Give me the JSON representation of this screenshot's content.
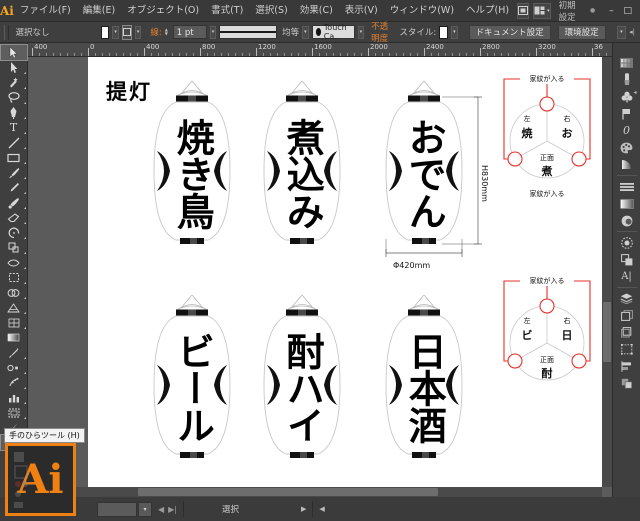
{
  "app": {
    "logo": "Ai",
    "window_buttons": {
      "minimize": "–",
      "maximize": "□",
      "close": "✕"
    }
  },
  "menubar": {
    "items": [
      {
        "label": "ファイル(F)",
        "name": "menu-file"
      },
      {
        "label": "編集(E)",
        "name": "menu-edit"
      },
      {
        "label": "オブジェクト(O)",
        "name": "menu-object"
      },
      {
        "label": "書式(T)",
        "name": "menu-type"
      },
      {
        "label": "選択(S)",
        "name": "menu-select"
      },
      {
        "label": "効果(C)",
        "name": "menu-effect"
      },
      {
        "label": "表示(V)",
        "name": "menu-view"
      },
      {
        "label": "ウィンドウ(W)",
        "name": "menu-window"
      },
      {
        "label": "ヘルプ(H)",
        "name": "menu-help"
      }
    ],
    "workspace": "初期設定"
  },
  "controlbar": {
    "selection_status": "選択なし",
    "stroke_label": "線:",
    "stroke_weight": "1 pt",
    "stroke_profile": "均等",
    "brush_name": "Touch Ca..",
    "opacity_label": "不透明度",
    "style_label": "スタイル:",
    "document_setup": "ドキュメント設定",
    "preferences": "環境設定"
  },
  "rulers": {
    "horizontal_labels": [
      "400",
      "0",
      "400",
      "800",
      "1200",
      "1600",
      "2000",
      "2400",
      "2800",
      "3200",
      "36"
    ],
    "unit": "mm"
  },
  "toolbar": {
    "tools": [
      {
        "name": "selection-tool",
        "icon": "cursor-arrow-icon",
        "selected": false
      },
      {
        "name": "direct-selection-tool",
        "icon": "direct-cursor-icon",
        "selected": false
      },
      {
        "name": "magic-wand-tool",
        "icon": "magic-wand-icon",
        "selected": false
      },
      {
        "name": "lasso-tool",
        "icon": "lasso-icon",
        "selected": false
      },
      {
        "name": "pen-tool",
        "icon": "pen-icon",
        "selected": false
      },
      {
        "name": "type-tool",
        "icon": "type-t-icon",
        "selected": false
      },
      {
        "name": "line-segment-tool",
        "icon": "line-icon",
        "selected": false
      },
      {
        "name": "rectangle-tool",
        "icon": "rectangle-icon",
        "selected": false
      },
      {
        "name": "paintbrush-tool",
        "icon": "paintbrush-icon",
        "selected": false
      },
      {
        "name": "pencil-tool",
        "icon": "pencil-icon",
        "selected": false
      },
      {
        "name": "blob-brush-tool",
        "icon": "blob-brush-icon",
        "selected": false
      },
      {
        "name": "eraser-tool",
        "icon": "eraser-icon",
        "selected": false
      },
      {
        "name": "rotate-tool",
        "icon": "rotate-icon",
        "selected": false
      },
      {
        "name": "scale-tool",
        "icon": "scale-icon",
        "selected": false
      },
      {
        "name": "width-tool",
        "icon": "width-warp-icon",
        "selected": false
      },
      {
        "name": "free-transform-tool",
        "icon": "free-transform-icon",
        "selected": false
      },
      {
        "name": "shape-builder-tool",
        "icon": "shape-builder-icon",
        "selected": false
      },
      {
        "name": "perspective-grid-tool",
        "icon": "perspective-grid-icon",
        "selected": false
      },
      {
        "name": "mesh-tool",
        "icon": "mesh-icon",
        "selected": false
      },
      {
        "name": "gradient-tool",
        "icon": "gradient-icon",
        "selected": false
      },
      {
        "name": "eyedropper-tool",
        "icon": "eyedropper-icon",
        "selected": false
      },
      {
        "name": "blend-tool",
        "icon": "blend-icon",
        "selected": false
      },
      {
        "name": "symbol-sprayer-tool",
        "icon": "symbol-sprayer-icon",
        "selected": false
      },
      {
        "name": "column-graph-tool",
        "icon": "bar-graph-icon",
        "selected": false
      },
      {
        "name": "artboard-tool",
        "icon": "artboard-icon",
        "selected": false
      },
      {
        "name": "slice-tool",
        "icon": "slice-knife-icon",
        "selected": false
      },
      {
        "name": "hand-tool",
        "icon": "hand-icon",
        "selected": true
      }
    ],
    "tooltip": "手のひらツール (H)"
  },
  "rightdock": {
    "buttons": [
      {
        "name": "panel-color-guide",
        "icon": "color-guide-icon"
      },
      {
        "name": "panel-brushes",
        "icon": "brush-panel-icon"
      },
      {
        "name": "panel-symbols",
        "icon": "clover-symbol-icon"
      },
      {
        "name": "panel-flag",
        "icon": "flag-icon"
      },
      {
        "name": "panel-stroke",
        "icon": "stroke-zero-icon"
      },
      {
        "name": "panel-color",
        "icon": "color-wheel-icon"
      },
      {
        "name": "panel-gradient",
        "icon": "gradient-panel-icon"
      },
      {
        "name": "panel-align",
        "icon": "align-lines-icon"
      },
      {
        "name": "panel-transparency",
        "icon": "transparency-icon"
      },
      {
        "name": "panel-appearance",
        "icon": "appearance-circle-icon"
      },
      {
        "name": "panel-graphic-styles",
        "icon": "graphic-styles-icon"
      },
      {
        "name": "panel-pathfinder",
        "icon": "pathfinder-icon"
      },
      {
        "name": "panel-character",
        "icon": "character-a-icon"
      },
      {
        "name": "panel-layers",
        "icon": "layers-stack-icon"
      },
      {
        "name": "panel-artboards",
        "icon": "artboards-panel-icon"
      },
      {
        "name": "panel-links",
        "icon": "links-icon"
      },
      {
        "name": "panel-transform",
        "icon": "transform-grid-icon"
      },
      {
        "name": "panel-align-objects",
        "icon": "align-objects-icon"
      },
      {
        "name": "panel-pathfinder2",
        "icon": "pathfinder-shapes-icon"
      }
    ]
  },
  "document": {
    "title": "提灯",
    "lanterns": [
      {
        "name": "lantern-yakitori",
        "text": "焼き鳥",
        "chars": 3
      },
      {
        "name": "lantern-nikomi",
        "text": "煮込み",
        "chars": 3
      },
      {
        "name": "lantern-oden",
        "text": "おでん",
        "chars": 3
      },
      {
        "name": "lantern-beer",
        "text": "ビール",
        "chars": 3
      },
      {
        "name": "lantern-chuhai",
        "text": "酎ハイ",
        "chars": 3
      },
      {
        "name": "lantern-nihonshu",
        "text": "日本酒",
        "chars": 3
      }
    ],
    "dimensions": {
      "height": "H830mm",
      "diameter": "Φ420mm"
    },
    "crest_diagrams": [
      {
        "name": "crest-diagram-top",
        "top_label": "家紋が入る",
        "bottom_label": "家紋が入る",
        "left_label": "左",
        "right_label": "右",
        "front_label": "正面",
        "left_char": "焼",
        "right_char": "お",
        "front_char": "煮"
      },
      {
        "name": "crest-diagram-bottom",
        "top_label": "家紋が入る",
        "bottom_label": "",
        "left_label": "左",
        "right_label": "右",
        "front_label": "正面",
        "left_char": "ビ",
        "right_char": "日",
        "front_char": "酎"
      }
    ]
  },
  "statusbar": {
    "zoom": "",
    "status_text": "選択"
  },
  "colors": {
    "accent": "#f08012",
    "chrome": "#3b3b3b",
    "canvas": "#5b5b5b",
    "crest_red": "#e8312a"
  }
}
